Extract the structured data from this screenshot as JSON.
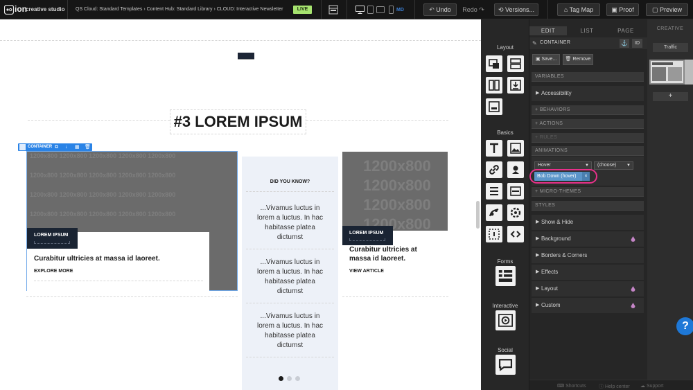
{
  "topbar": {
    "logo_text": "ion",
    "logo_sub": "creative studio",
    "breadcrumb": "QS Cloud: Standard Templates › Content Hub: Standard Library › CLOUD: Interactive Newsletter",
    "live_badge": "LIVE",
    "device_size": "MD",
    "undo_label": "Undo",
    "redo_label": "Redo",
    "versions_label": "Versions...",
    "tagmap_label": "Tag Map",
    "proof_label": "Proof",
    "preview_label": "Preview"
  },
  "canvas": {
    "section_title": "#3 LOREM IPSUM",
    "container_label": "CONTAINER",
    "placeholder_text": "1200x800",
    "card1": {
      "badge": "LOREM IPSUM",
      "headline": "Curabitur ultricies at massa id laoreet.",
      "link": "EXPLORE MORE"
    },
    "card2": {
      "title": "DID YOU KNOW?",
      "facts": [
        "...Vivamus luctus in lorem a luctus. In hac habitasse platea dictumst",
        "...Vivamus luctus in lorem a luctus. In hac habitasse platea dictumst",
        "...Vivamus luctus in lorem a luctus. In hac habitasse platea dictumst"
      ],
      "active_dot": 0,
      "dot_count": 3
    },
    "card3": {
      "badge": "LOREM IPSUM",
      "headline": "Curabitur ultricies at massa id laoreet.",
      "link": "VIEW ARTICLE"
    }
  },
  "toolstrip": {
    "layout_label": "Layout",
    "basics_label": "Basics",
    "forms_label": "Forms",
    "interactive_label": "Interactive",
    "social_label": "Social"
  },
  "editor": {
    "tabs": [
      "EDIT",
      "LIST",
      "PAGE"
    ],
    "active_tab": "EDIT",
    "element_type": "CONTAINER",
    "id_button": "ID",
    "save_label": "Save...",
    "remove_label": "Remove",
    "variables_header": "VARIABLES",
    "accessibility": "Accessibility",
    "behaviors": "+ BEHAVIORS",
    "actions": "+ ACTIONS",
    "rules": "+ RULES",
    "animations_header": "ANIMATIONS",
    "trigger_select": "Hover",
    "effect_select": "(choose)",
    "animation_tag": "Bob Down (hover)",
    "micro_themes": "+ MICRO-THEMES",
    "styles_header": "STYLES",
    "styles": [
      "Show & Hide",
      "Background",
      "Borders & Corners",
      "Effects",
      "Layout",
      "Custom"
    ]
  },
  "creative": {
    "tab": "CREATIVE",
    "traffic_label": "Traffic",
    "add_label": "+"
  },
  "footer": {
    "shortcuts": "Shortcuts",
    "help_center": "Help center",
    "support": "Support"
  },
  "help_button": "?",
  "colors": {
    "accent_blue": "#2a83e6",
    "live_green": "#a6e36f",
    "highlight_pink": "#e8308a",
    "dark_badge": "#1a2433",
    "info_bg": "#edf1f8"
  }
}
